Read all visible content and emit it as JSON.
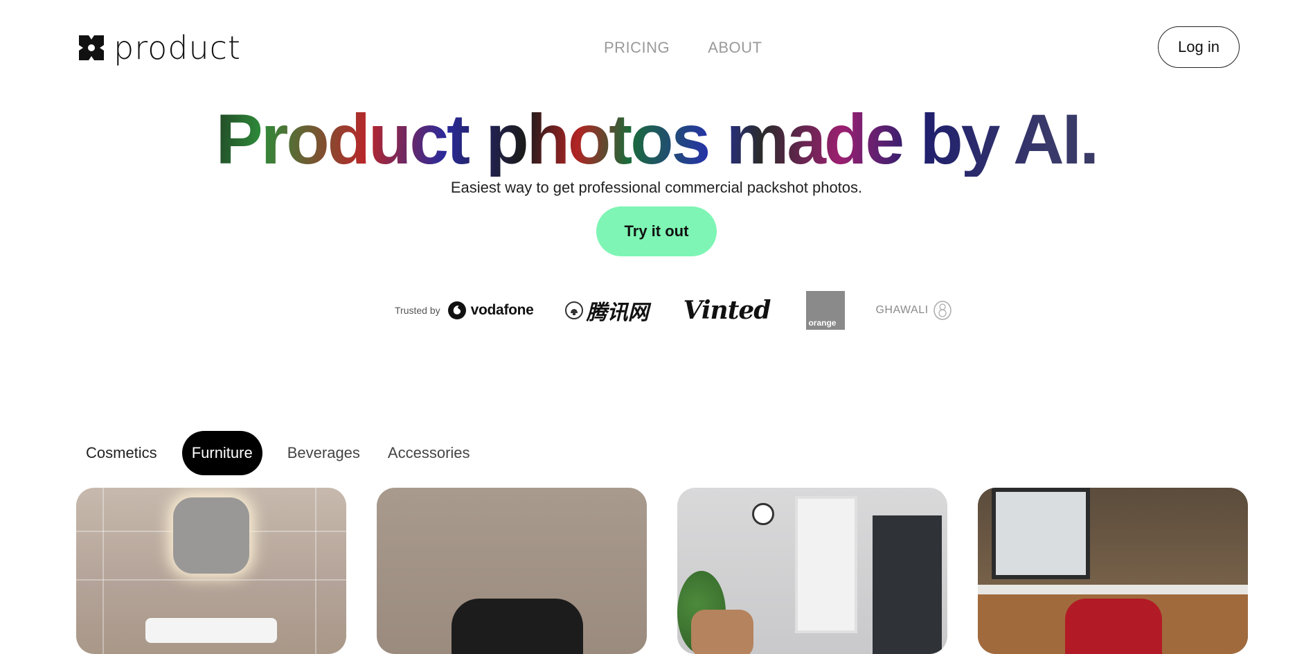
{
  "header": {
    "logo_text": "product",
    "nav": [
      "PRICING",
      "ABOUT"
    ],
    "login_label": "Log in"
  },
  "hero": {
    "title": "Product photos made by AI.",
    "subtitle": "Easiest way to get professional commercial packshot photos.",
    "cta_label": "Try it out"
  },
  "trusted": {
    "label": "Trusted by",
    "logos": {
      "vodafone": "vodafone",
      "tencent": "腾讯网",
      "vinted": "Vinted",
      "orange": "orange",
      "ghawali": "GHAWALI"
    }
  },
  "categories": {
    "tabs": [
      "Cosmetics",
      "Furniture",
      "Beverages",
      "Accessories"
    ],
    "active": "Furniture"
  },
  "colors": {
    "cta": "#7ef5b4",
    "active_tab": "#000000",
    "nav_text": "#9a9a9a"
  },
  "icons": [
    "logo-mark-icon",
    "vodafone-icon",
    "tencent-bell-icon",
    "ghawali-emblem-icon"
  ]
}
